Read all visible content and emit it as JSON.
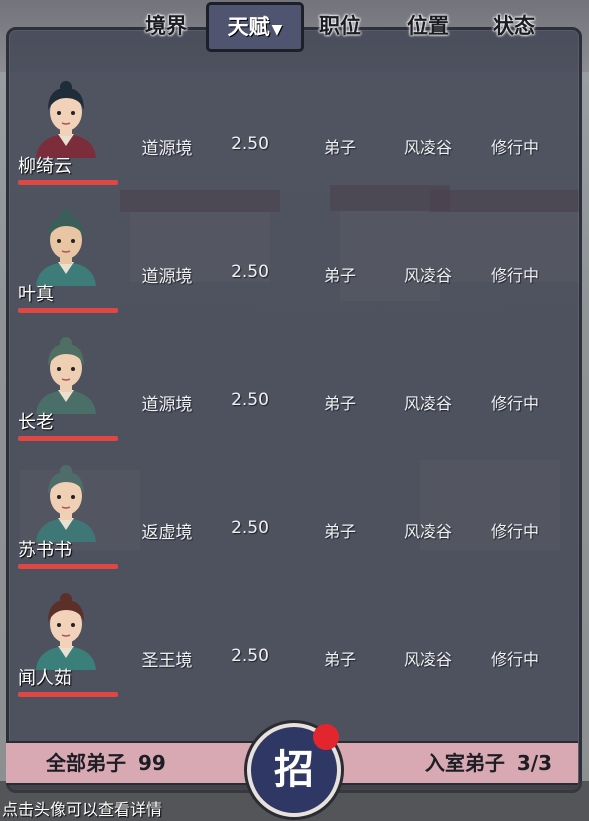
{
  "tabs": [
    {
      "label": "境界",
      "active": false
    },
    {
      "label": "天赋",
      "active": true,
      "sort_icon": "triangle-down-icon"
    },
    {
      "label": "职位",
      "active": false
    },
    {
      "label": "位置",
      "active": false
    },
    {
      "label": "状态",
      "active": false
    }
  ],
  "disciples": [
    {
      "name": "柳绮云",
      "realm": "道源境",
      "talent": "2.50",
      "position": "弟子",
      "location": "风凌谷",
      "status": "修行中",
      "hair": "#1f2c3a",
      "robe": "#7b2d3b",
      "skin": "#f1d1b8"
    },
    {
      "name": "叶真",
      "realm": "道源境",
      "talent": "2.50",
      "position": "弟子",
      "location": "风凌谷",
      "status": "修行中",
      "hair": "#3b5f58",
      "robe": "#3d7c79",
      "skin": "#e9c6a3"
    },
    {
      "name": "长老",
      "realm": "道源境",
      "talent": "2.50",
      "position": "弟子",
      "location": "风凌谷",
      "status": "修行中",
      "hair": "#4f6f63",
      "robe": "#4a6f68",
      "skin": "#efcfb4"
    },
    {
      "name": "苏书书",
      "realm": "返虚境",
      "talent": "2.50",
      "position": "弟子",
      "location": "风凌谷",
      "status": "修行中",
      "hair": "#4e6d6a",
      "robe": "#3f7676",
      "skin": "#f0d0b5"
    },
    {
      "name": "闻人茹",
      "realm": "圣王境",
      "talent": "2.50",
      "position": "弟子",
      "location": "风凌谷",
      "status": "修行中",
      "hair": "#5c3028",
      "robe": "#3b7f7a",
      "skin": "#f2d2ba"
    }
  ],
  "bottom": {
    "all_label": "全部弟子",
    "all_count": "99",
    "recruit_label": "招",
    "inner_label": "入室弟子",
    "inner_count": "3/3"
  },
  "hint": "点击头像可以查看详情",
  "colors": {
    "panel": "#3c4050",
    "accent_tab": "#4f5470",
    "hp_bar": "#e04646",
    "bottom_bar": "#d9a9b3",
    "recruit_dot": "#e3262e"
  }
}
